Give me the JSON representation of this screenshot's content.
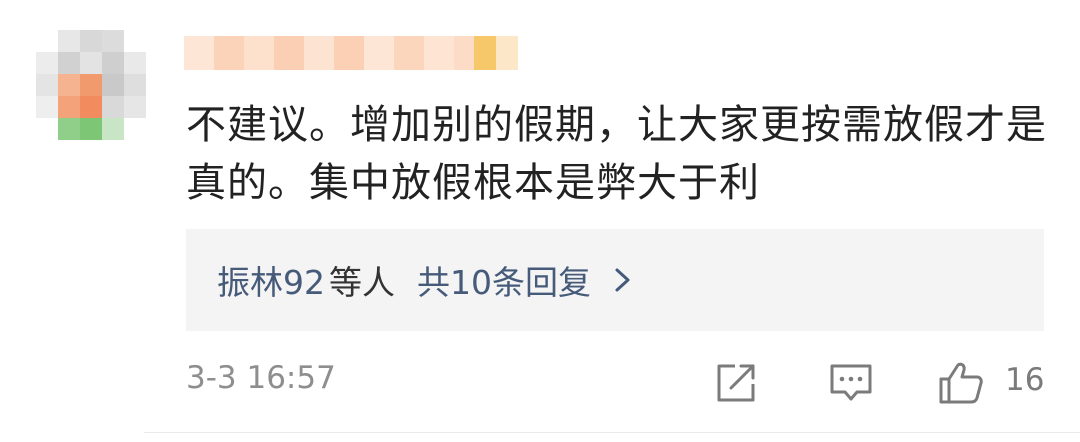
{
  "comment": {
    "text": "不建议。增加别的假期，让大家更按需放假才是真的。集中放假根本是弊大于利"
  },
  "replies": {
    "users": "振林92",
    "suffix": "等人",
    "count_label": "共10条回复"
  },
  "meta": {
    "timestamp": "3-3 16:57",
    "like_count": "16"
  },
  "icons": {
    "chevron": "chevron-right-icon",
    "share": "share-icon",
    "comment": "comment-icon",
    "like": "thumbs-up-icon"
  },
  "colors": {
    "link": "#465a7a",
    "text": "#222222",
    "muted": "#8e8e8e",
    "reply_bg": "#f4f4f4"
  }
}
